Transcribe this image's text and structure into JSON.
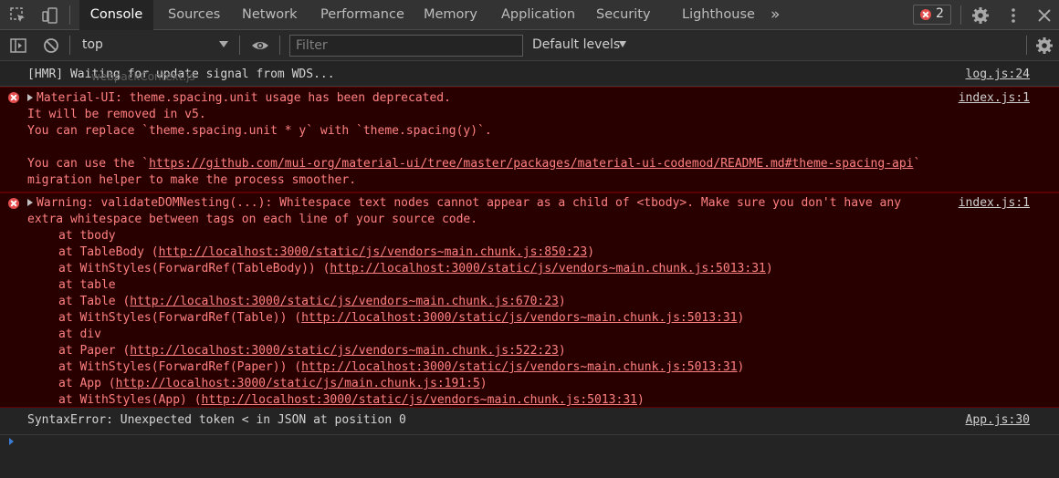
{
  "tabs": {
    "items": [
      "Console",
      "Sources",
      "Network",
      "Performance",
      "Memory",
      "Application",
      "Security",
      "Lighthouse"
    ],
    "more": "»",
    "error_count": "2"
  },
  "toolbar": {
    "context": "top",
    "filter_placeholder": "Filter",
    "levels": "Default levels"
  },
  "console": {
    "hmr": {
      "text": "[HMR] Waiting for update signal from WDS...",
      "source": "log.js:24",
      "ghost": "webpackContext.js"
    },
    "mui": {
      "source": "index.js:1",
      "lines": [
        "Material-UI: theme.spacing.unit usage has been deprecated.",
        "It will be removed in v5.",
        "You can replace `theme.spacing.unit * y` with `theme.spacing(y)`.",
        "",
        "You can use the `",
        "https://github.com/mui-org/material-ui/tree/master/packages/material-ui-codemod/README.md#theme-spacing-api",
        "`",
        "migration helper to make the process smoother."
      ]
    },
    "warning": {
      "source": "index.js:1",
      "line1": "Warning: validateDOMNesting(...): Whitespace text nodes cannot appear as a child of <tbody>. Make sure you don't have any",
      "line2": "extra whitespace between tags on each line of your source code.",
      "stack": [
        {
          "pre": "at tbody",
          "url": "",
          "post": ""
        },
        {
          "pre": "at TableBody (",
          "url": "http://localhost:3000/static/js/vendors~main.chunk.js:850:23",
          "post": ")"
        },
        {
          "pre": "at WithStyles(ForwardRef(TableBody)) (",
          "url": "http://localhost:3000/static/js/vendors~main.chunk.js:5013:31",
          "post": ")"
        },
        {
          "pre": "at table",
          "url": "",
          "post": ""
        },
        {
          "pre": "at Table (",
          "url": "http://localhost:3000/static/js/vendors~main.chunk.js:670:23",
          "post": ")"
        },
        {
          "pre": "at WithStyles(ForwardRef(Table)) (",
          "url": "http://localhost:3000/static/js/vendors~main.chunk.js:5013:31",
          "post": ")"
        },
        {
          "pre": "at div",
          "url": "",
          "post": ""
        },
        {
          "pre": "at Paper (",
          "url": "http://localhost:3000/static/js/vendors~main.chunk.js:522:23",
          "post": ")"
        },
        {
          "pre": "at WithStyles(ForwardRef(Paper)) (",
          "url": "http://localhost:3000/static/js/vendors~main.chunk.js:5013:31",
          "post": ")"
        },
        {
          "pre": "at App (",
          "url": "http://localhost:3000/static/js/main.chunk.js:191:5",
          "post": ")"
        },
        {
          "pre": "at WithStyles(App) (",
          "url": "http://localhost:3000/static/js/vendors~main.chunk.js:5013:31",
          "post": ")"
        }
      ]
    },
    "syntax": {
      "text": "SyntaxError: Unexpected token < in JSON at position 0",
      "source": "App.js:30"
    }
  },
  "colors": {
    "error_bg": "#290000",
    "error_text": "#ff8080",
    "accent": "#3a7cd6"
  }
}
